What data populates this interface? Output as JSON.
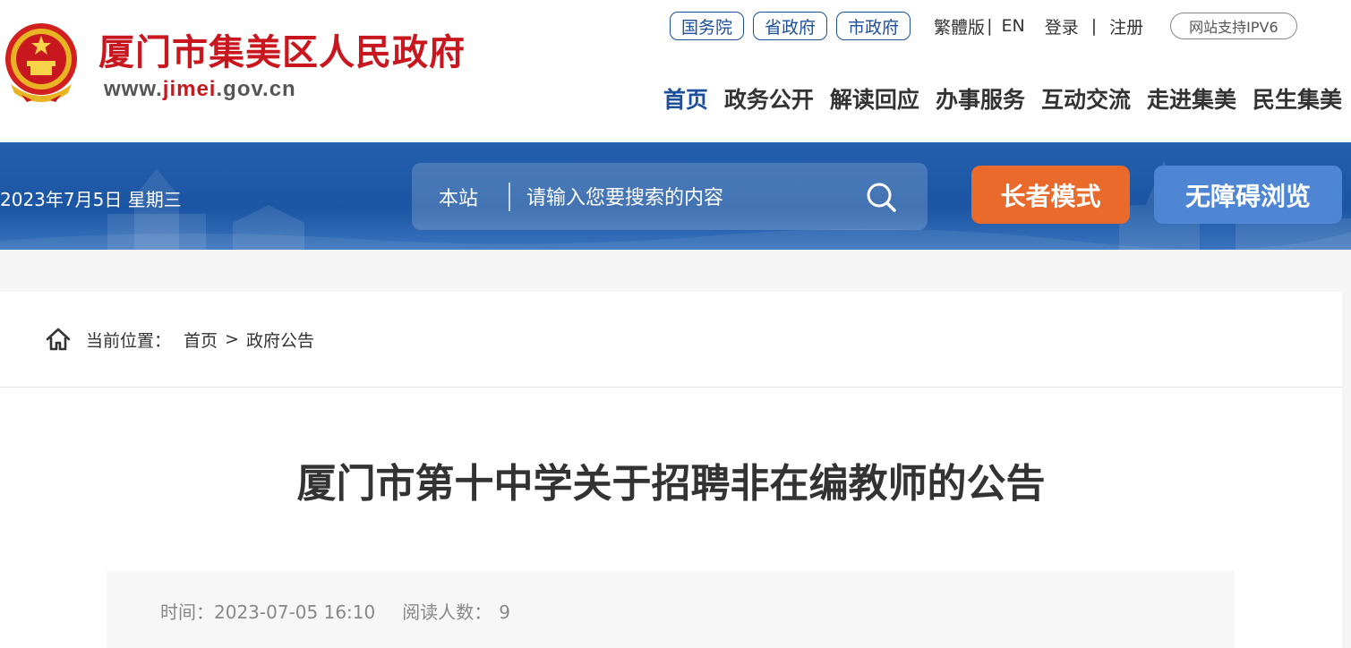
{
  "header": {
    "site_name": "厦门市集美区人民政府",
    "site_url_prefix": "www.",
    "site_url_highlight": "jimei",
    "site_url_suffix": ".gov.cn",
    "top_links": [
      "国务院",
      "省政府",
      "市政府"
    ],
    "traditional": "繁體版",
    "english": "EN",
    "login": "登录",
    "separator": "|",
    "register": "注册",
    "ipv6": "网站支持IPV6",
    "nav": [
      "首页",
      "政务公开",
      "解读回应",
      "办事服务",
      "互动交流",
      "走进集美",
      "民生集美"
    ],
    "active_nav": "首页",
    "colors": {
      "brand_red": "#c8171e",
      "brand_blue": "#1c4f9c"
    }
  },
  "banner": {
    "date": "2023年7月5日 星期三",
    "search_scope": "本站",
    "search_placeholder": "请输入您要搜索的内容",
    "elder_mode": "长者模式",
    "accessible": "无障碍浏览",
    "colors": {
      "elder": "#ea6a2c",
      "accessible": "#4f86d3"
    }
  },
  "breadcrumb": {
    "label": "当前位置：",
    "home": "首页",
    "sep": ">",
    "current": "政府公告"
  },
  "article": {
    "title": "厦门市第十中学关于招聘非在编教师的公告",
    "time_label": "时间：",
    "time": "2023-07-05 16:10",
    "reads_label": "阅读人数：",
    "reads": "9"
  }
}
